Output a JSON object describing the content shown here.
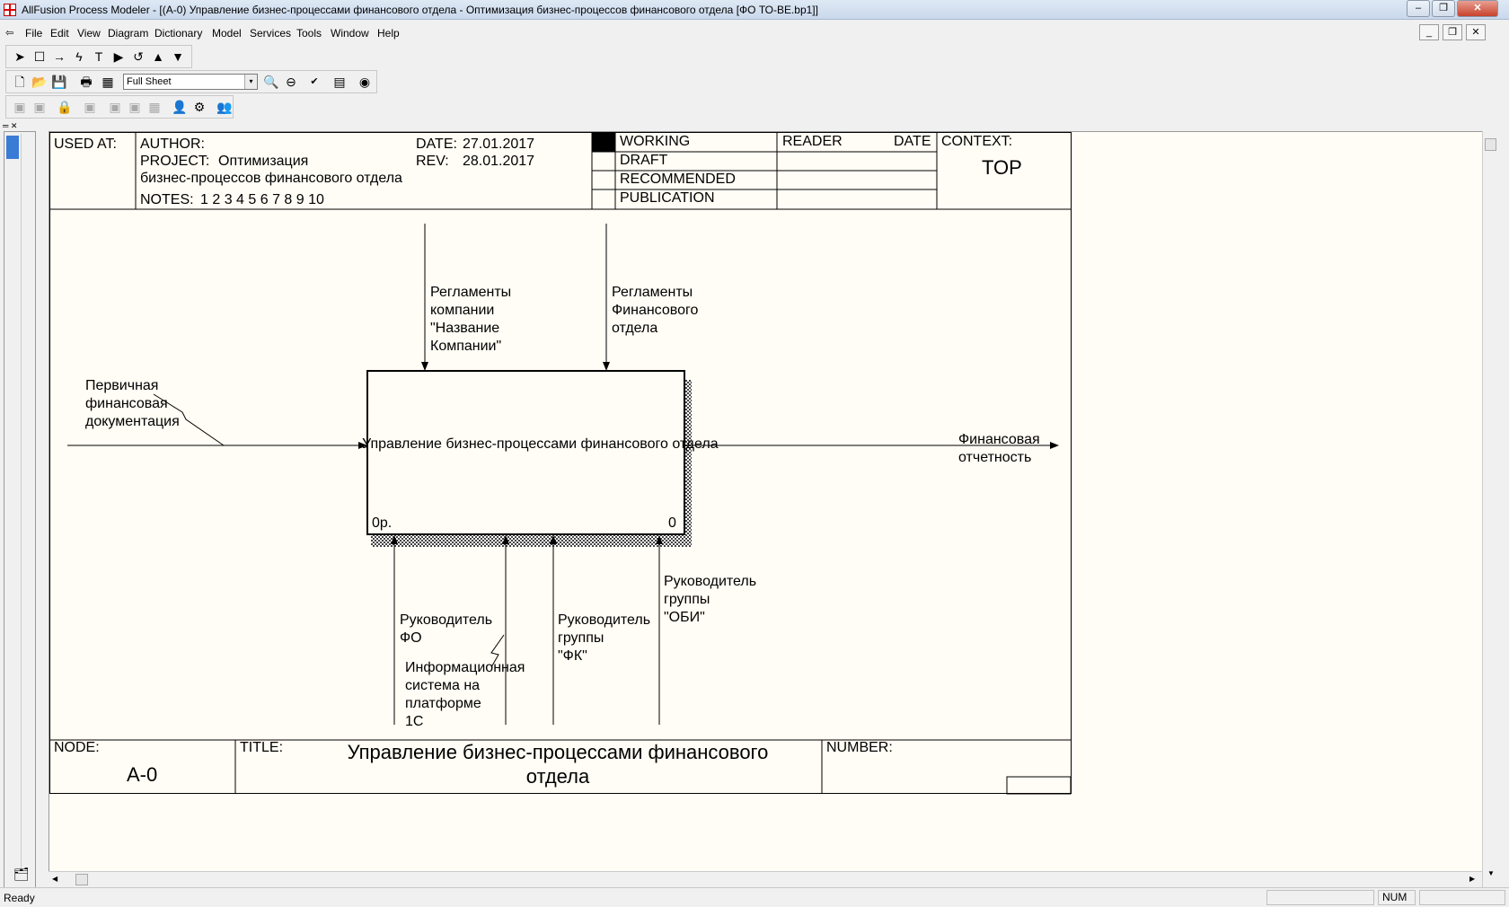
{
  "window": {
    "title": "AllFusion Process Modeler - [(A-0) Управление бизнес-процессами финансового отдела - Оптимизация бизнес-процессов финансового отдела  [ФО ТО-ВЕ.bp1]]",
    "btn_min": "–",
    "btn_max": "❐",
    "btn_close": "✕"
  },
  "menu": {
    "items": [
      "File",
      "Edit",
      "View",
      "Diagram",
      "Dictionary",
      "Model",
      "Services",
      "Tools",
      "Window",
      "Help"
    ],
    "mdi_min": "_",
    "mdi_max": "❐",
    "mdi_close": "✕"
  },
  "toolbar": {
    "zoom_value": "Full Sheet",
    "zoom_arrow": "▾"
  },
  "header": {
    "used_at": "USED AT:",
    "author": "AUTHOR:",
    "project_label": "PROJECT:",
    "project_value": "Оптимизация",
    "project_value2": "бизнес-процессов финансового отдела",
    "notes_label": "NOTES:",
    "notes_value": "1  2  3  4  5  6  7  8  9  10",
    "date_label": "DATE:",
    "date_value": "27.01.2017",
    "rev_label": "REV:",
    "rev_value": "28.01.2017",
    "status_working": "WORKING",
    "status_draft": "DRAFT",
    "status_recommended": "RECOMMENDED",
    "status_publication": "PUBLICATION",
    "reader": "READER",
    "date2": "DATE",
    "context": "CONTEXT:",
    "context_value": "TOP"
  },
  "diagram": {
    "activity_name": "Управление бизнес-процессами финансового отдела",
    "activity_cost": "0р.",
    "activity_number": "0",
    "arrows": {
      "control_1": "Регламенты\nкомпании\n\"Название\nКомпании\"",
      "control_2": "Регламенты\nФинансового\nотдела",
      "input_1": "Первичная\nфинансовая\nдокументация",
      "output_1": "Финансовая\nотчетность",
      "mechanism_1": "Руководитель\nФО",
      "mechanism_2": "Информационная\nсистема на\nплатформе\n1С",
      "mechanism_3": "Руководитель\nгруппы\n\"ФК\"",
      "mechanism_4": "Руководитель\nгруппы\n\"ОБИ\""
    }
  },
  "footer": {
    "node_label": "NODE:",
    "node_value": "A-0",
    "title_label": "TITLE:",
    "title_line1": "Управление бизнес-процессами финансового",
    "title_line2": "отдела",
    "number_label": "NUMBER:"
  },
  "status": {
    "text": "Ready",
    "num": "NUM"
  }
}
